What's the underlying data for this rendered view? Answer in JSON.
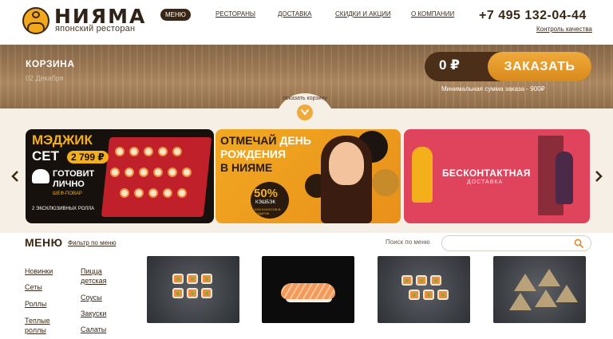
{
  "header": {
    "brand_name": "НИЯМА",
    "brand_subtitle": "японский ресторан",
    "nav": {
      "active": "МЕНЮ",
      "items": [
        "РЕСТОРАНЫ",
        "ДОСТАВКА",
        "СКИДКИ И АКЦИИ",
        "О КОМПАНИИ"
      ]
    },
    "phone": "+7 495 132-04-44",
    "quality_link": "Контроль качества"
  },
  "cart": {
    "title": "КОРЗИНА",
    "date": "02 Декабря",
    "total": "0 ₽",
    "order_button": "ЗАКАЗАТЬ",
    "min_order": "Минимальная сумма заказа - 900₽",
    "show_cart": "показать корзину"
  },
  "promos": {
    "p1": {
      "title1": "МЭДЖИК",
      "title2": "СЕТ",
      "price": "2 799 ₽",
      "chef_text": "ГОТОВИТ ЛИЧНО",
      "chef_sub": "ШЕФ-ПОВАР",
      "rolls": "2 ЭКСКЛЮЗИВНЫХ РОЛЛА"
    },
    "p2": {
      "title_a": "ОТМЕЧАЙ",
      "title_b": "ДЕНЬ",
      "title_c": "РОЖДЕНИЯ",
      "title_d": "В НИЯМЕ",
      "percent": "50%",
      "cashback": "КЭШБЭК",
      "gift": "1000 БОНУСОВ В ПОДАРОК"
    },
    "p3": {
      "title": "БЕСКОНТАКТНАЯ",
      "subtitle": "ДОСТАВКА"
    }
  },
  "menu": {
    "title": "МЕНЮ",
    "filter": "Фильтр по меню",
    "search_label": "Поиск по меню",
    "search_placeholder": "",
    "categories_col1": [
      "Новинки",
      "Сеты",
      "Роллы",
      "Теплые роллы"
    ],
    "categories_col2": [
      "Пицца детская",
      "Соусы",
      "Закуски",
      "Салаты"
    ]
  },
  "colors": {
    "brand_dark": "#3a2614",
    "accent_orange": "#f0a93a",
    "promo_red": "#e0445c"
  },
  "icons": [
    "chevron-down-icon",
    "chevron-left-icon",
    "chevron-right-icon",
    "search-icon",
    "logo-icon"
  ]
}
